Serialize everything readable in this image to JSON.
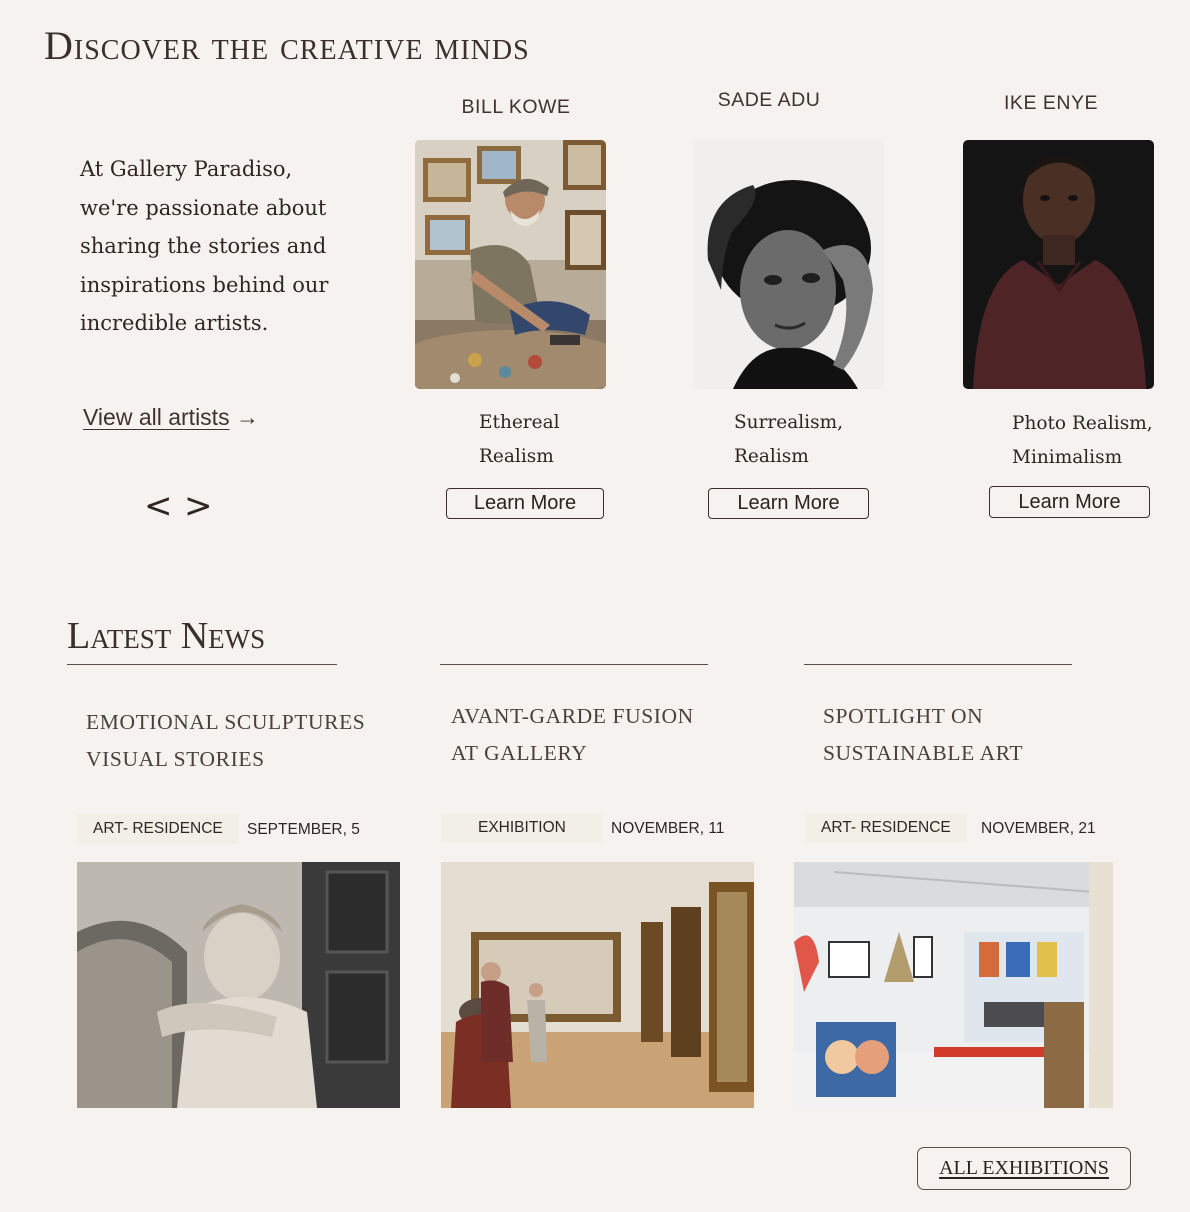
{
  "discover": {
    "title": "Discover the creative minds",
    "intro": "At Gallery Paradiso, we're passionate about sharing the stories and inspirations behind our incredible artists.",
    "view_all": "View all artists",
    "view_all_arrow": "→",
    "prev": "<",
    "next": ">",
    "artists": [
      {
        "name": "BILL KOWE",
        "genre_line1": "Ethereal",
        "genre_line2": "Realism",
        "button": "Learn More"
      },
      {
        "name": "SADE ADU",
        "genre_line1": "Surrealism,",
        "genre_line2": "Realism",
        "button": "Learn More"
      },
      {
        "name": "IKE ENYE",
        "genre_line1": "Photo Realism,",
        "genre_line2": "Minimalism",
        "button": "Learn More"
      }
    ]
  },
  "news": {
    "title": "Latest News",
    "items": [
      {
        "line1": "EMOTIONAL SCULPTURES",
        "line2": "VISUAL STORIES",
        "tag": "ART- RESIDENCE",
        "date": "SEPTEMBER,  5"
      },
      {
        "line1": "AVANT-GARDE FUSION",
        "line2": "AT GALLERY",
        "tag": "EXHIBITION",
        "date": "NOVEMBER,  11"
      },
      {
        "line1": "SPOTLIGHT ON",
        "line2": "SUSTAINABLE ART",
        "tag": "ART- RESIDENCE",
        "date": "NOVEMBER,  21"
      }
    ],
    "all_button": "ALL EXHIBITIONS"
  }
}
